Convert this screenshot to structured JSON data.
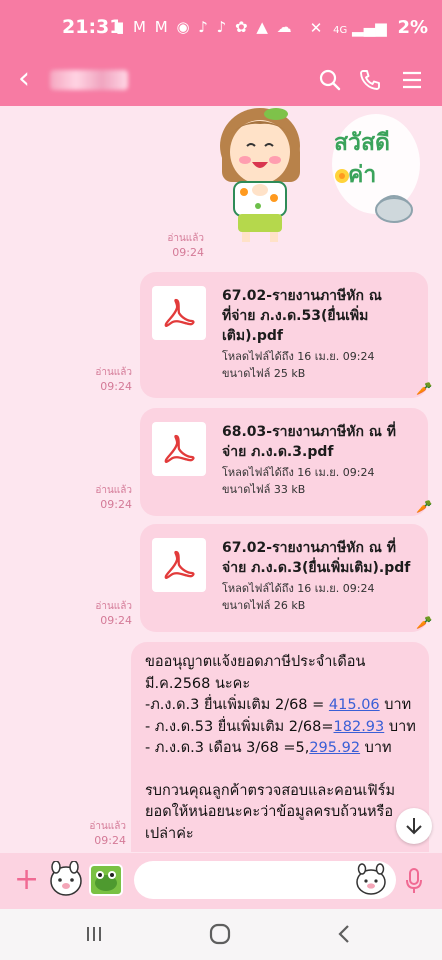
{
  "status_bar": {
    "time": "21:31",
    "notification_icons": "▮ M M ◉ ♪ ♪ ✿ ▲ ☁",
    "network": "4G",
    "battery": "2%"
  },
  "header": {
    "back_icon": "chevron-left-icon",
    "search_icon": "search-icon",
    "call_icon": "phone-icon",
    "menu_icon": "menu-icon"
  },
  "sticker": {
    "caption_line1": "สวัสดี",
    "caption_line2": "ค่า",
    "read_label": "อ่านแล้ว",
    "read_time": "09:24"
  },
  "files": [
    {
      "name": "67.02-รายงานภาษีหัก ณ ที่จ่าย ภ.ง.ด.53(ยื่นเพิ่ม เติม).pdf",
      "name_lines": [
        "67.02-รายงานภาษีหัก ณ",
        "ที่จ่าย ภ.ง.ด.53(ยื่นเพิ่ม",
        "เติม).pdf"
      ],
      "download_status": "โหลดไฟล์ได้ถึง 16 เม.ย. 09:24",
      "size": "ขนาดไฟล์ 25 kB",
      "read_label": "อ่านแล้ว",
      "read_time": "09:24"
    },
    {
      "name": "68.03-รายงานภาษีหัก ณ ที่จ่าย ภ.ง.ด.3.pdf",
      "name_lines": [
        "68.03-รายงานภาษีหัก ณ ที่",
        "จ่าย ภ.ง.ด.3.pdf"
      ],
      "download_status": "โหลดไฟล์ได้ถึง 16 เม.ย. 09:24",
      "size": "ขนาดไฟล์ 33 kB",
      "read_label": "อ่านแล้ว",
      "read_time": "09:24"
    },
    {
      "name": "67.02-รายงานภาษีหัก ณ ที่จ่าย ภ.ง.ด.3(ยื่นเพิ่มเติม).pdf",
      "name_lines": [
        "67.02-รายงานภาษีหัก ณ ที่",
        "จ่าย ภ.ง.ด.3(ยื่นเพิ่มเติม).pdf"
      ],
      "download_status": "โหลดไฟล์ได้ถึง 16 เม.ย. 09:24",
      "size": "ขนาดไฟล์ 26 kB",
      "read_label": "อ่านแล้ว",
      "read_time": "09:24"
    }
  ],
  "text_message": {
    "line1": "ขออนุญาตแจ้งยอดภาษีประจำเดือน",
    "line2": "มี.ค.2568 นะคะ",
    "line3_prefix": "-ภ.ง.ด.3 ยื่นเพิ่มเติม 2/68 = ",
    "line3_amount": "415.06",
    "line3_unit": " บาท",
    "line4_prefix": "- ภ.ง.ด.53 ยื่นเพิ่มเติม 2/68=",
    "line4_amount": "182.93",
    "line4_unit": " บาท",
    "line5_prefix": "- ภ.ง.ด.3 เดือน 3/68  =5,",
    "line5_amount": "295.92",
    "line5_unit": " บาท",
    "line6": "รบกวนคุณลูกค้าตรวจสอบและคอนเฟิร์ม",
    "line7": "ยอดให้หน่อยนะคะว่าข้อมูลครบถ้วนหรือ",
    "line8": "เปล่าค่ะ",
    "read_label": "อ่านแล้ว",
    "read_time": "09:24"
  },
  "input_bar": {
    "placeholder": ""
  },
  "colors": {
    "accent": "#f77ba3",
    "chat_background": "#fde6ef",
    "bubble": "#fcd3e1",
    "pdf_red": "#e23b3b",
    "link_blue": "#3a5fd6"
  }
}
